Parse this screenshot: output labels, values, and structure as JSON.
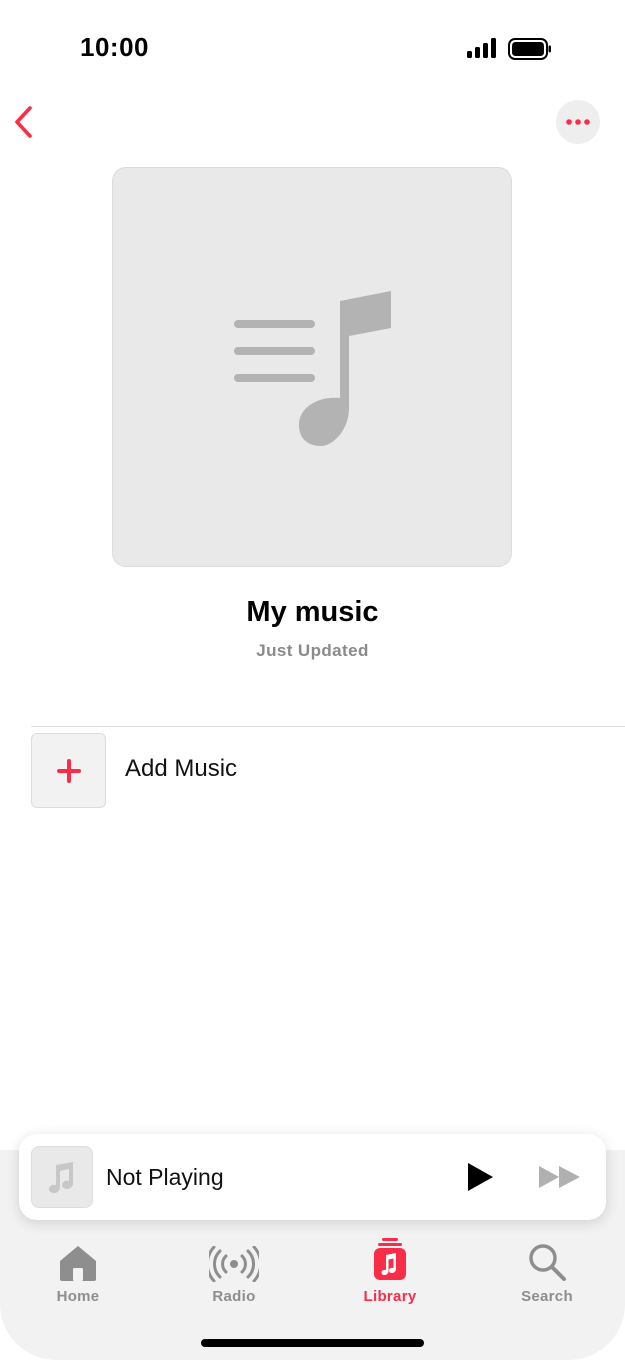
{
  "status_bar": {
    "time": "10:00"
  },
  "colors": {
    "accent": "#fa2d48",
    "inactive": "#8e8e8e",
    "artwork_bg": "#e9e9e9"
  },
  "nav": {
    "back_icon": "chevron-left-icon",
    "more_icon": "ellipsis-icon"
  },
  "playlist": {
    "title": "My music",
    "subtitle": "Just Updated",
    "artwork_icon": "playlist-music-note-icon"
  },
  "add_music": {
    "label": "Add Music",
    "icon": "plus-icon"
  },
  "mini_player": {
    "title": "Not Playing",
    "artwork_icon": "music-note-icon",
    "play_icon": "play-icon",
    "forward_icon": "fast-forward-icon"
  },
  "tabs": [
    {
      "label": "Home",
      "icon": "house-icon",
      "active": false
    },
    {
      "label": "Radio",
      "icon": "radio-waves-icon",
      "active": false
    },
    {
      "label": "Library",
      "icon": "library-icon",
      "active": true
    },
    {
      "label": "Search",
      "icon": "magnifying-glass-icon",
      "active": false
    }
  ]
}
